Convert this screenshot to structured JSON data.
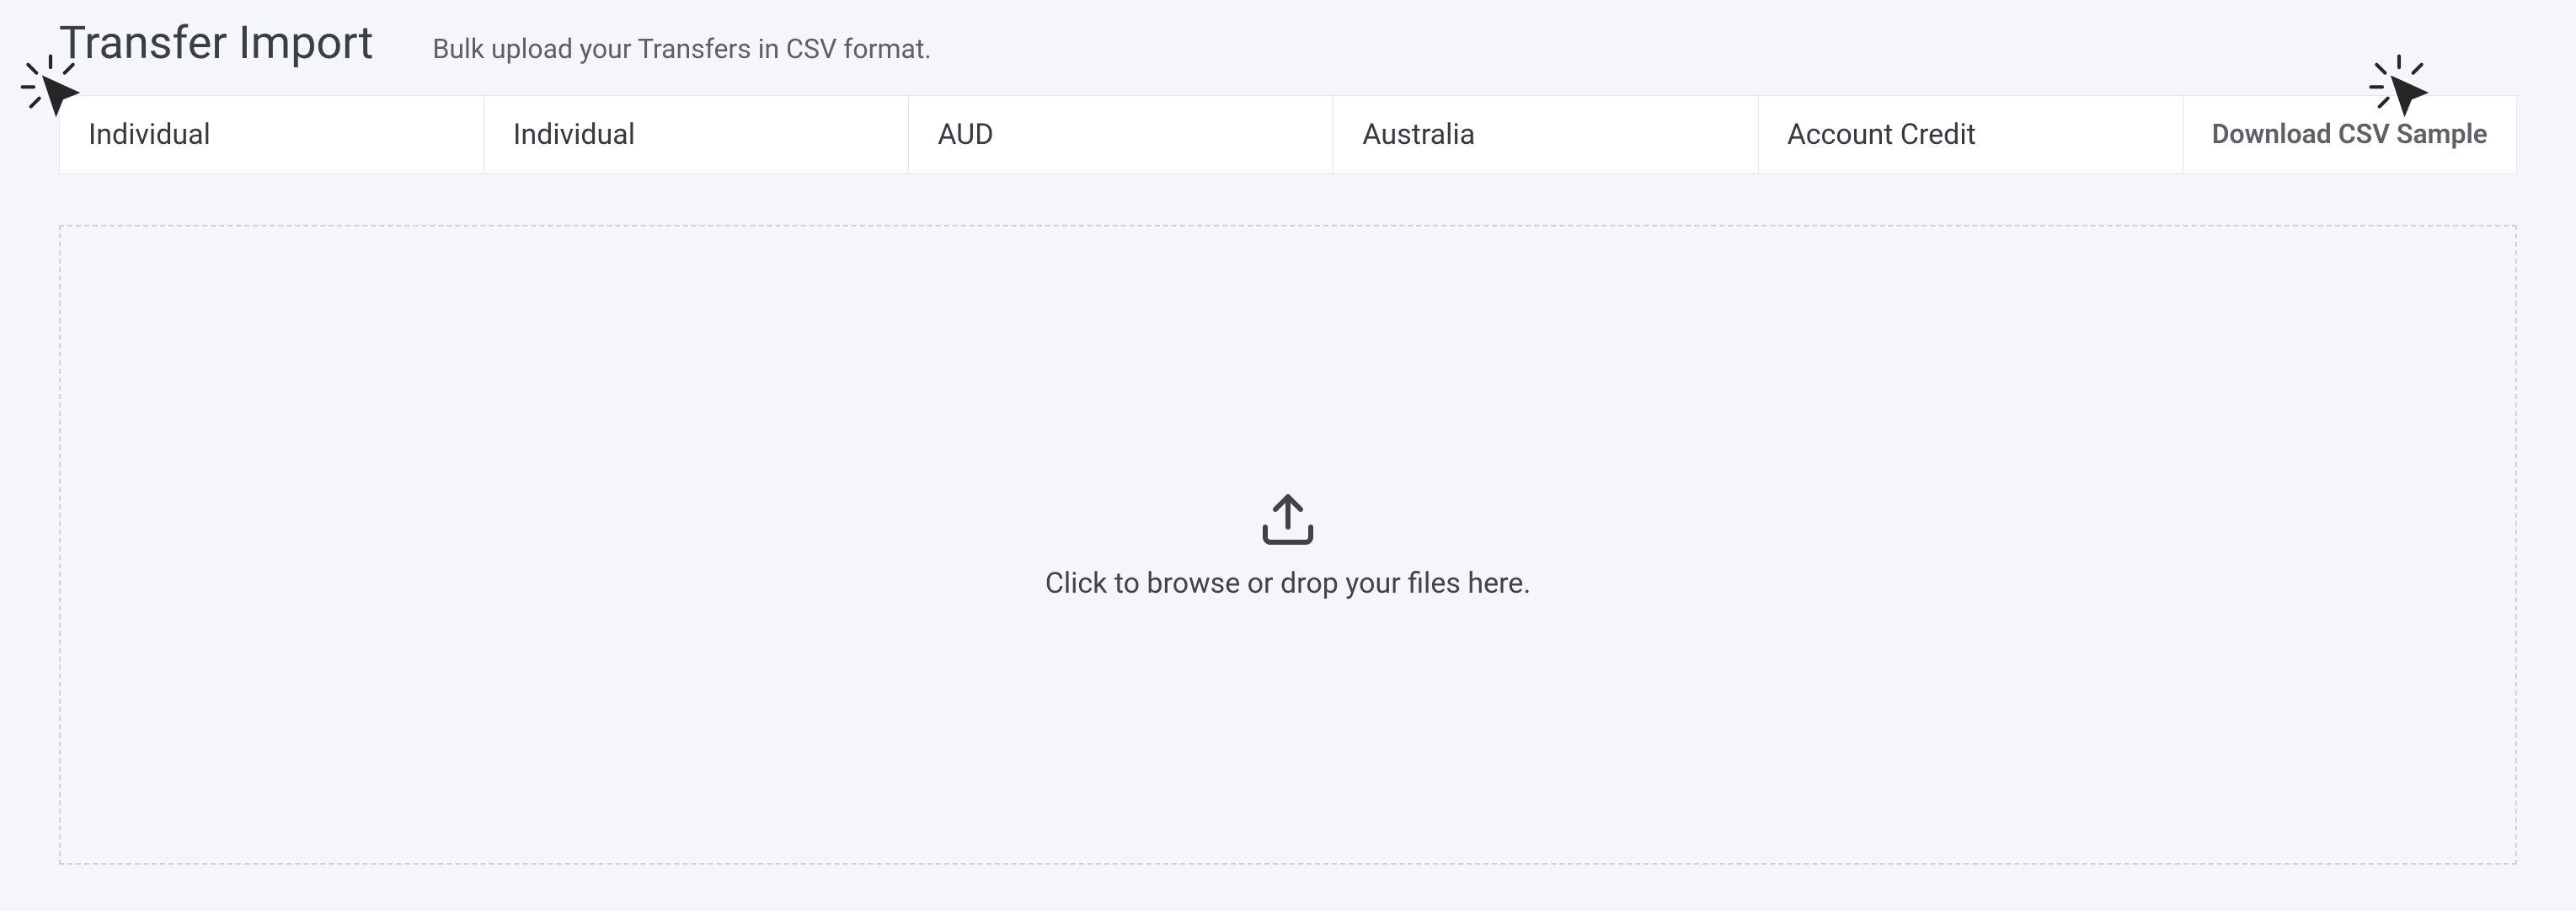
{
  "header": {
    "title": "Transfer Import",
    "subtitle": "Bulk upload your Transfers in CSV format."
  },
  "filters": {
    "col1": "Individual",
    "col2": "Individual",
    "col3": "AUD",
    "col4": "Australia",
    "col5": "Account Credit",
    "download_label": "Download CSV Sample"
  },
  "dropzone": {
    "text": "Click to browse or drop your files here."
  }
}
